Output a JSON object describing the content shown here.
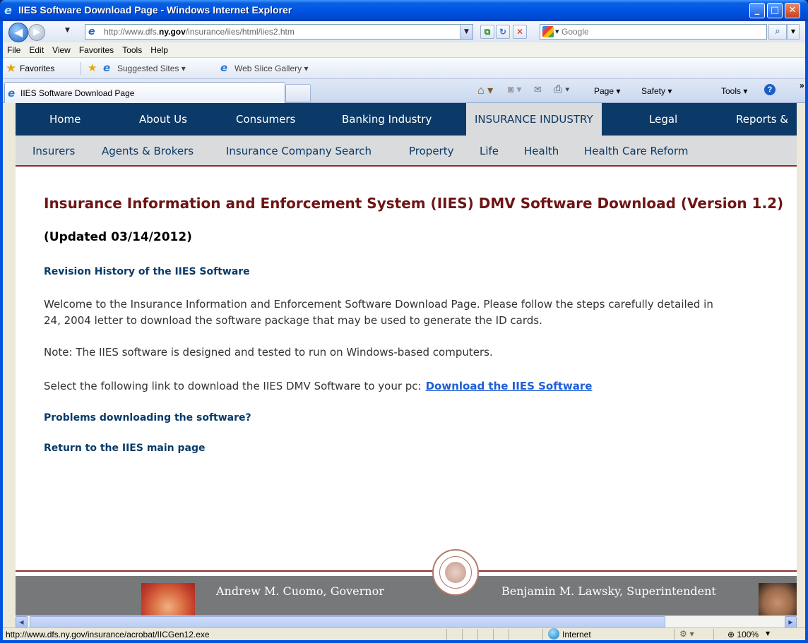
{
  "window": {
    "title": "IIES Software Download Page - Windows Internet Explorer",
    "minimize": "_",
    "maximize": "□",
    "close": "✕"
  },
  "address_bar": {
    "url_prefix": "http://www.dfs.",
    "url_domain": "ny.gov",
    "url_suffix": "/insurance/iies/html/iies2.htm",
    "search_placeholder": "Google"
  },
  "menu": [
    "File",
    "Edit",
    "View",
    "Favorites",
    "Tools",
    "Help"
  ],
  "favorites_bar": {
    "label": "Favorites",
    "items": [
      "Suggested Sites ▾",
      "Web Slice Gallery ▾"
    ]
  },
  "tab": {
    "title": "IIES Software Download Page"
  },
  "command_bar": {
    "page": "Page ▾",
    "safety": "Safety ▾",
    "tools": "Tools ▾",
    "help": "?",
    "more": "»"
  },
  "site_nav": [
    "Home",
    "About Us",
    "Consumers",
    "Banking Industry",
    "INSURANCE INDUSTRY",
    "Legal",
    "Reports &"
  ],
  "sub_nav": [
    "Insurers",
    "Agents & Brokers",
    "Insurance Company Search",
    "Property",
    "Life",
    "Health",
    "Health Care Reform"
  ],
  "main": {
    "title": "Insurance Information and Enforcement System (IIES) DMV Software Download (Version 1.2)",
    "updated": "(Updated 03/14/2012)",
    "revision_link": "Revision History of the IIES Software",
    "welcome_line1": "Welcome to the Insurance Information and Enforcement Software Download Page. Please follow the steps carefully detailed in",
    "welcome_line2": "24, 2004 letter to download the software package that may be used to generate the ID cards.",
    "note": "Note: The IIES software is designed and tested to run on Windows-based computers.",
    "select_text": "Select the following link to download the IIES DMV Software to your pc:",
    "download_link": "Download the IIES Software",
    "problems_link": "Problems downloading the software?",
    "return_link": "Return to the IIES main page"
  },
  "footer": {
    "governor": "Andrew M. Cuomo, Governor",
    "superintendent": "Benjamin M. Lawsky, Superintendent"
  },
  "status_bar": {
    "text": "http://www.dfs.ny.gov/insurance/acrobat/IICGen12.exe",
    "zone": "Internet",
    "zoom": "100%"
  },
  "colors": {
    "nav_bg": "#0b3a68",
    "active_tab_bg": "#dadbdc",
    "title_red": "#6e1414",
    "link_blue": "#1e5fd6",
    "footer_gray": "#777879"
  }
}
